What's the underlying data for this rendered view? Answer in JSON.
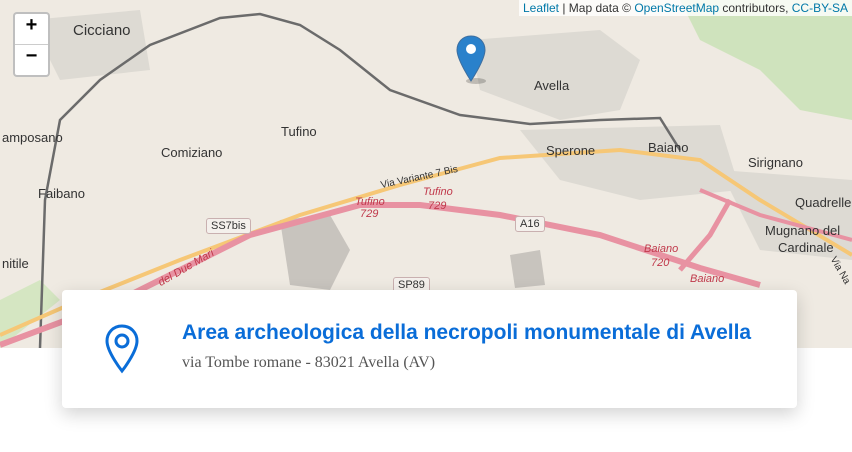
{
  "map": {
    "zoom_in": "+",
    "zoom_out": "−",
    "attribution": {
      "leaflet": "Leaflet",
      "separator": " | Map data © ",
      "osm": "OpenStreetMap",
      "contributors": " contributors, ",
      "license": "CC-BY-SA"
    },
    "places": [
      "Cicciano",
      "Avella",
      "Tufino",
      "Comiziano",
      "Sperone",
      "Baiano",
      "Sirignano",
      "amposano",
      "Faibano",
      "Quadrelle",
      "Mugnano del",
      "Cardinale",
      "nitile"
    ],
    "roads": [
      "SS7bis",
      "A16",
      "SP89",
      "Via Variante 7 Bis",
      "Tufino",
      "729",
      "Tufino",
      "729",
      "Baiano",
      "720",
      "Baiano",
      "del Due Mari",
      "Via Na"
    ],
    "marker_icon": "map-marker-icon"
  },
  "card": {
    "icon": "location-pin-icon",
    "title": "Area archeologica della necropoli monumentale di Avella",
    "address": "via Tombe romane - 83021 Avella (AV)"
  },
  "colors": {
    "accent": "#0a6dd8",
    "marker": "#2a81cb",
    "highway": "#e892a2",
    "primary_road": "#f6c776",
    "railway": "#555555"
  }
}
